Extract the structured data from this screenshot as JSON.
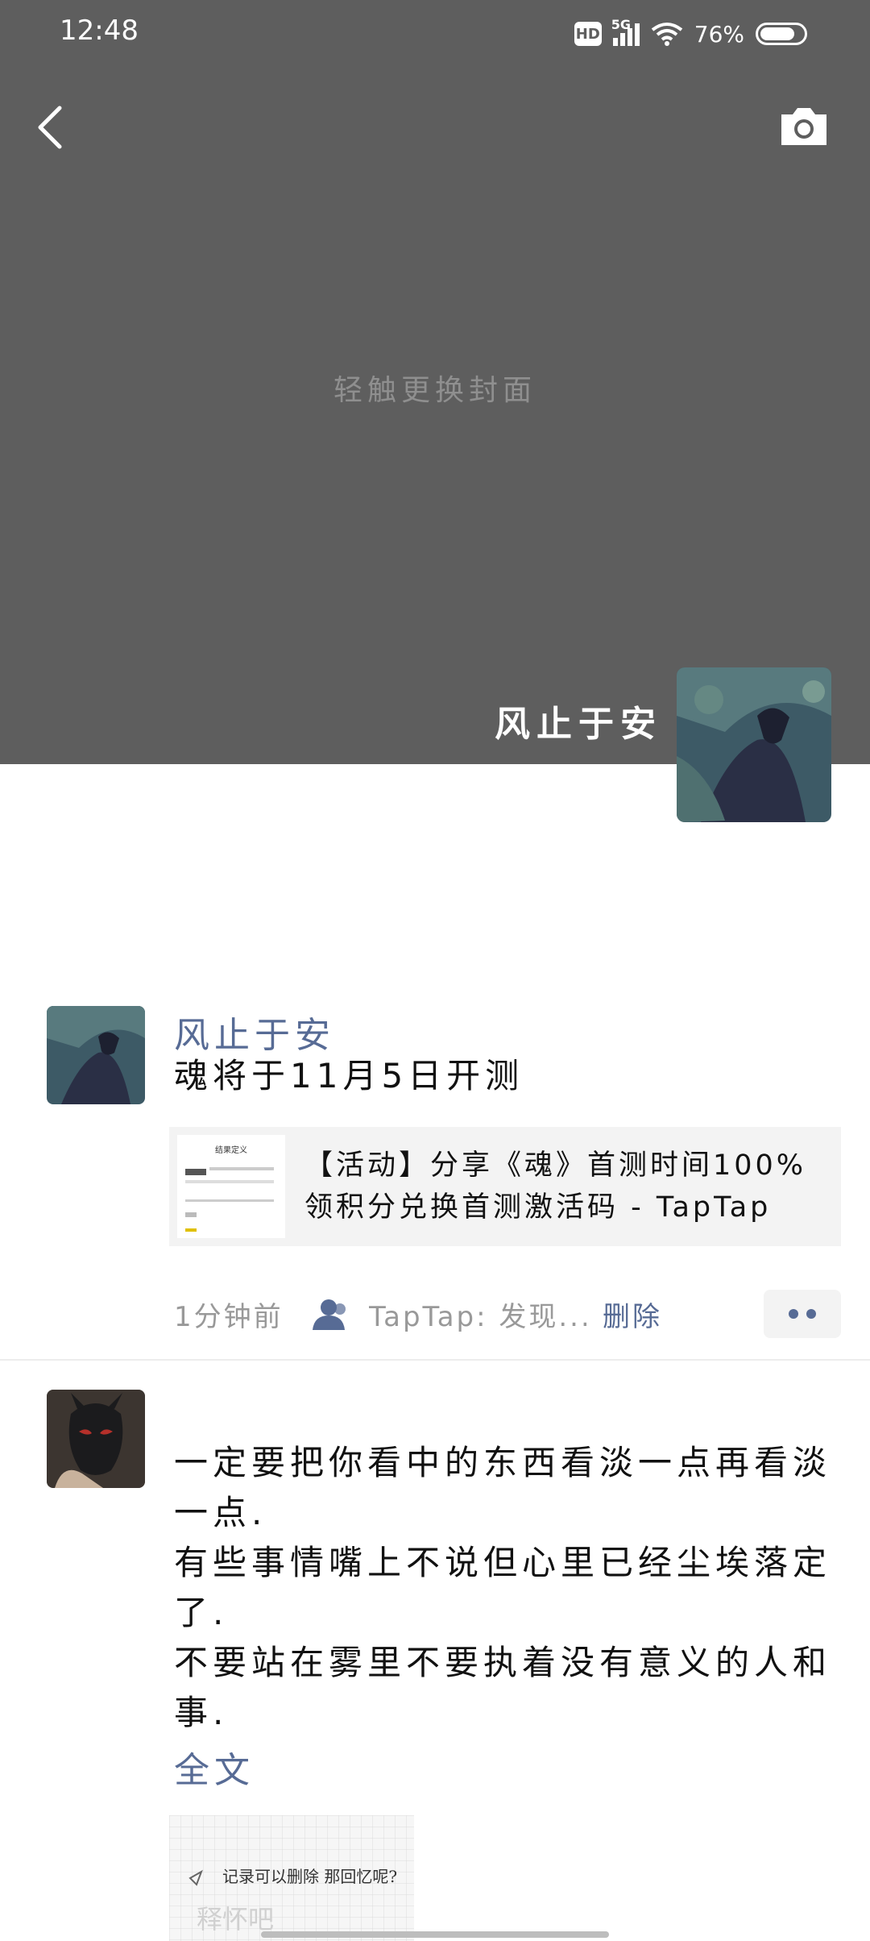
{
  "status_bar": {
    "time": "12:48",
    "hd": "HD",
    "network": "5G",
    "battery": "76%"
  },
  "cover": {
    "hint": "轻触更换封面",
    "user_name": "风止于安"
  },
  "posts": [
    {
      "author": "风止于安",
      "text": "魂将于11月5日开测",
      "link_card": {
        "title": "【活动】分享《魂》首测时间100%领积分兑换首测激活码 - TapTap",
        "thumb_heading": "结果定义"
      },
      "time": "1分钟前",
      "source": "TapTap: 发现...",
      "delete_label": "删除"
    },
    {
      "text_lines": [
        "一定要把你看中的东西看淡一点再看淡一点.",
        "有些事情嘴上不说但心里已经尘埃落定了.",
        "不要站在雾里不要执着没有意义的人和事."
      ],
      "fulltext_label": "全文",
      "image_text": "记录可以删除 那回忆呢?",
      "image_text2": "释怀吧"
    }
  ],
  "colors": {
    "link_blue": "#576b95",
    "cover_bg": "#5e5e5e"
  }
}
